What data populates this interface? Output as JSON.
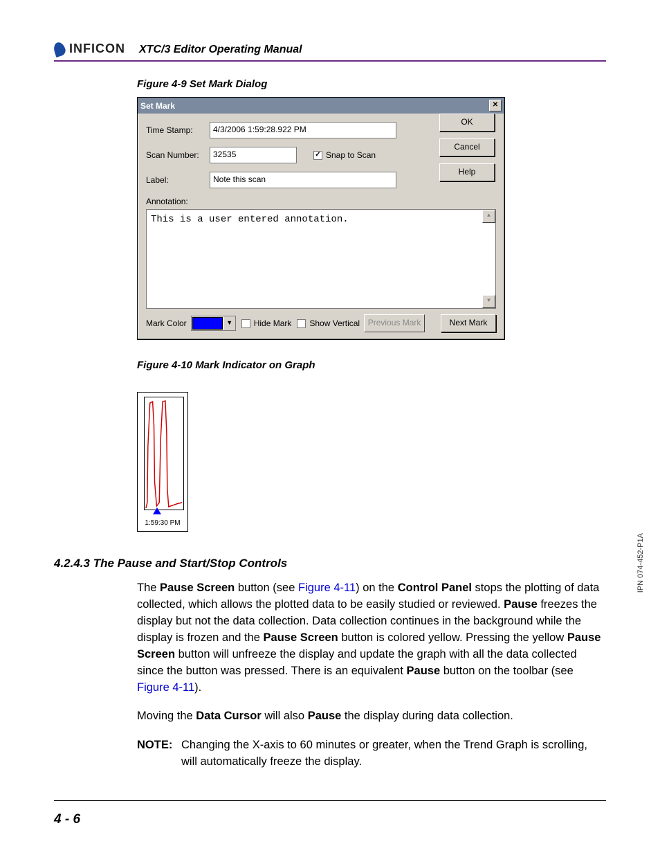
{
  "header": {
    "brand": "INFICON",
    "manual_title": "XTC/3 Editor Operating Manual"
  },
  "figure9": {
    "caption": "Figure 4-9  Set Mark Dialog",
    "title": "Set Mark",
    "labels": {
      "time_stamp": "Time Stamp:",
      "scan_number": "Scan Number:",
      "label": "Label:",
      "annotation": "Annotation:",
      "mark_color": "Mark Color"
    },
    "values": {
      "time_stamp": "4/3/2006 1:59:28.922 PM",
      "scan_number": "32535",
      "label": "Note this scan",
      "annotation_text": "This is a user entered annotation.",
      "mark_color_hex": "#0000ff"
    },
    "checkboxes": {
      "snap_to_scan": {
        "label": "Snap to Scan",
        "checked": true
      },
      "hide_mark": {
        "label": "Hide Mark",
        "checked": false
      },
      "show_vertical": {
        "label": "Show Vertical",
        "checked": false
      }
    },
    "buttons": {
      "ok": "OK",
      "cancel": "Cancel",
      "help": "Help",
      "previous_mark": "Previous Mark",
      "next_mark": "Next Mark"
    }
  },
  "figure10": {
    "caption": "Figure 4-10  Mark Indicator on Graph",
    "time_label": "1:59:30 PM"
  },
  "section": {
    "heading": "4.2.4.3  The Pause and Start/Stop Controls",
    "p1_a": "The ",
    "p1_b": "Pause Screen",
    "p1_c": " button (see ",
    "p1_link1": "Figure 4-11",
    "p1_d": ") on the ",
    "p1_e": "Control Panel",
    "p1_f": " stops the plotting of data collected, which allows the plotted data to be easily studied or reviewed. ",
    "p1_g": "Pause",
    "p1_h": " freezes the display but not the data collection. Data collection continues in the background while the display is frozen and the ",
    "p1_i": "Pause Screen",
    "p1_j": " button is colored yellow. Pressing the yellow ",
    "p1_k": "Pause Screen",
    "p1_l": " button will unfreeze the display and update the graph with all the data collected since the button was pressed. There is an equivalent ",
    "p1_m": "Pause",
    "p1_n": " button on the toolbar (see ",
    "p1_link2": "Figure 4-11",
    "p1_o": ").",
    "p2_a": "Moving the ",
    "p2_b": "Data Cursor",
    "p2_c": " will also ",
    "p2_d": "Pause",
    "p2_e": " the display during data collection.",
    "note_label": "NOTE:",
    "note_text": "Changing the X-axis to 60 minutes or greater, when the Trend Graph is scrolling, will automatically freeze the display."
  },
  "footer": {
    "page": "4 - 6",
    "ipn": "IPN 074-452-P1A"
  }
}
